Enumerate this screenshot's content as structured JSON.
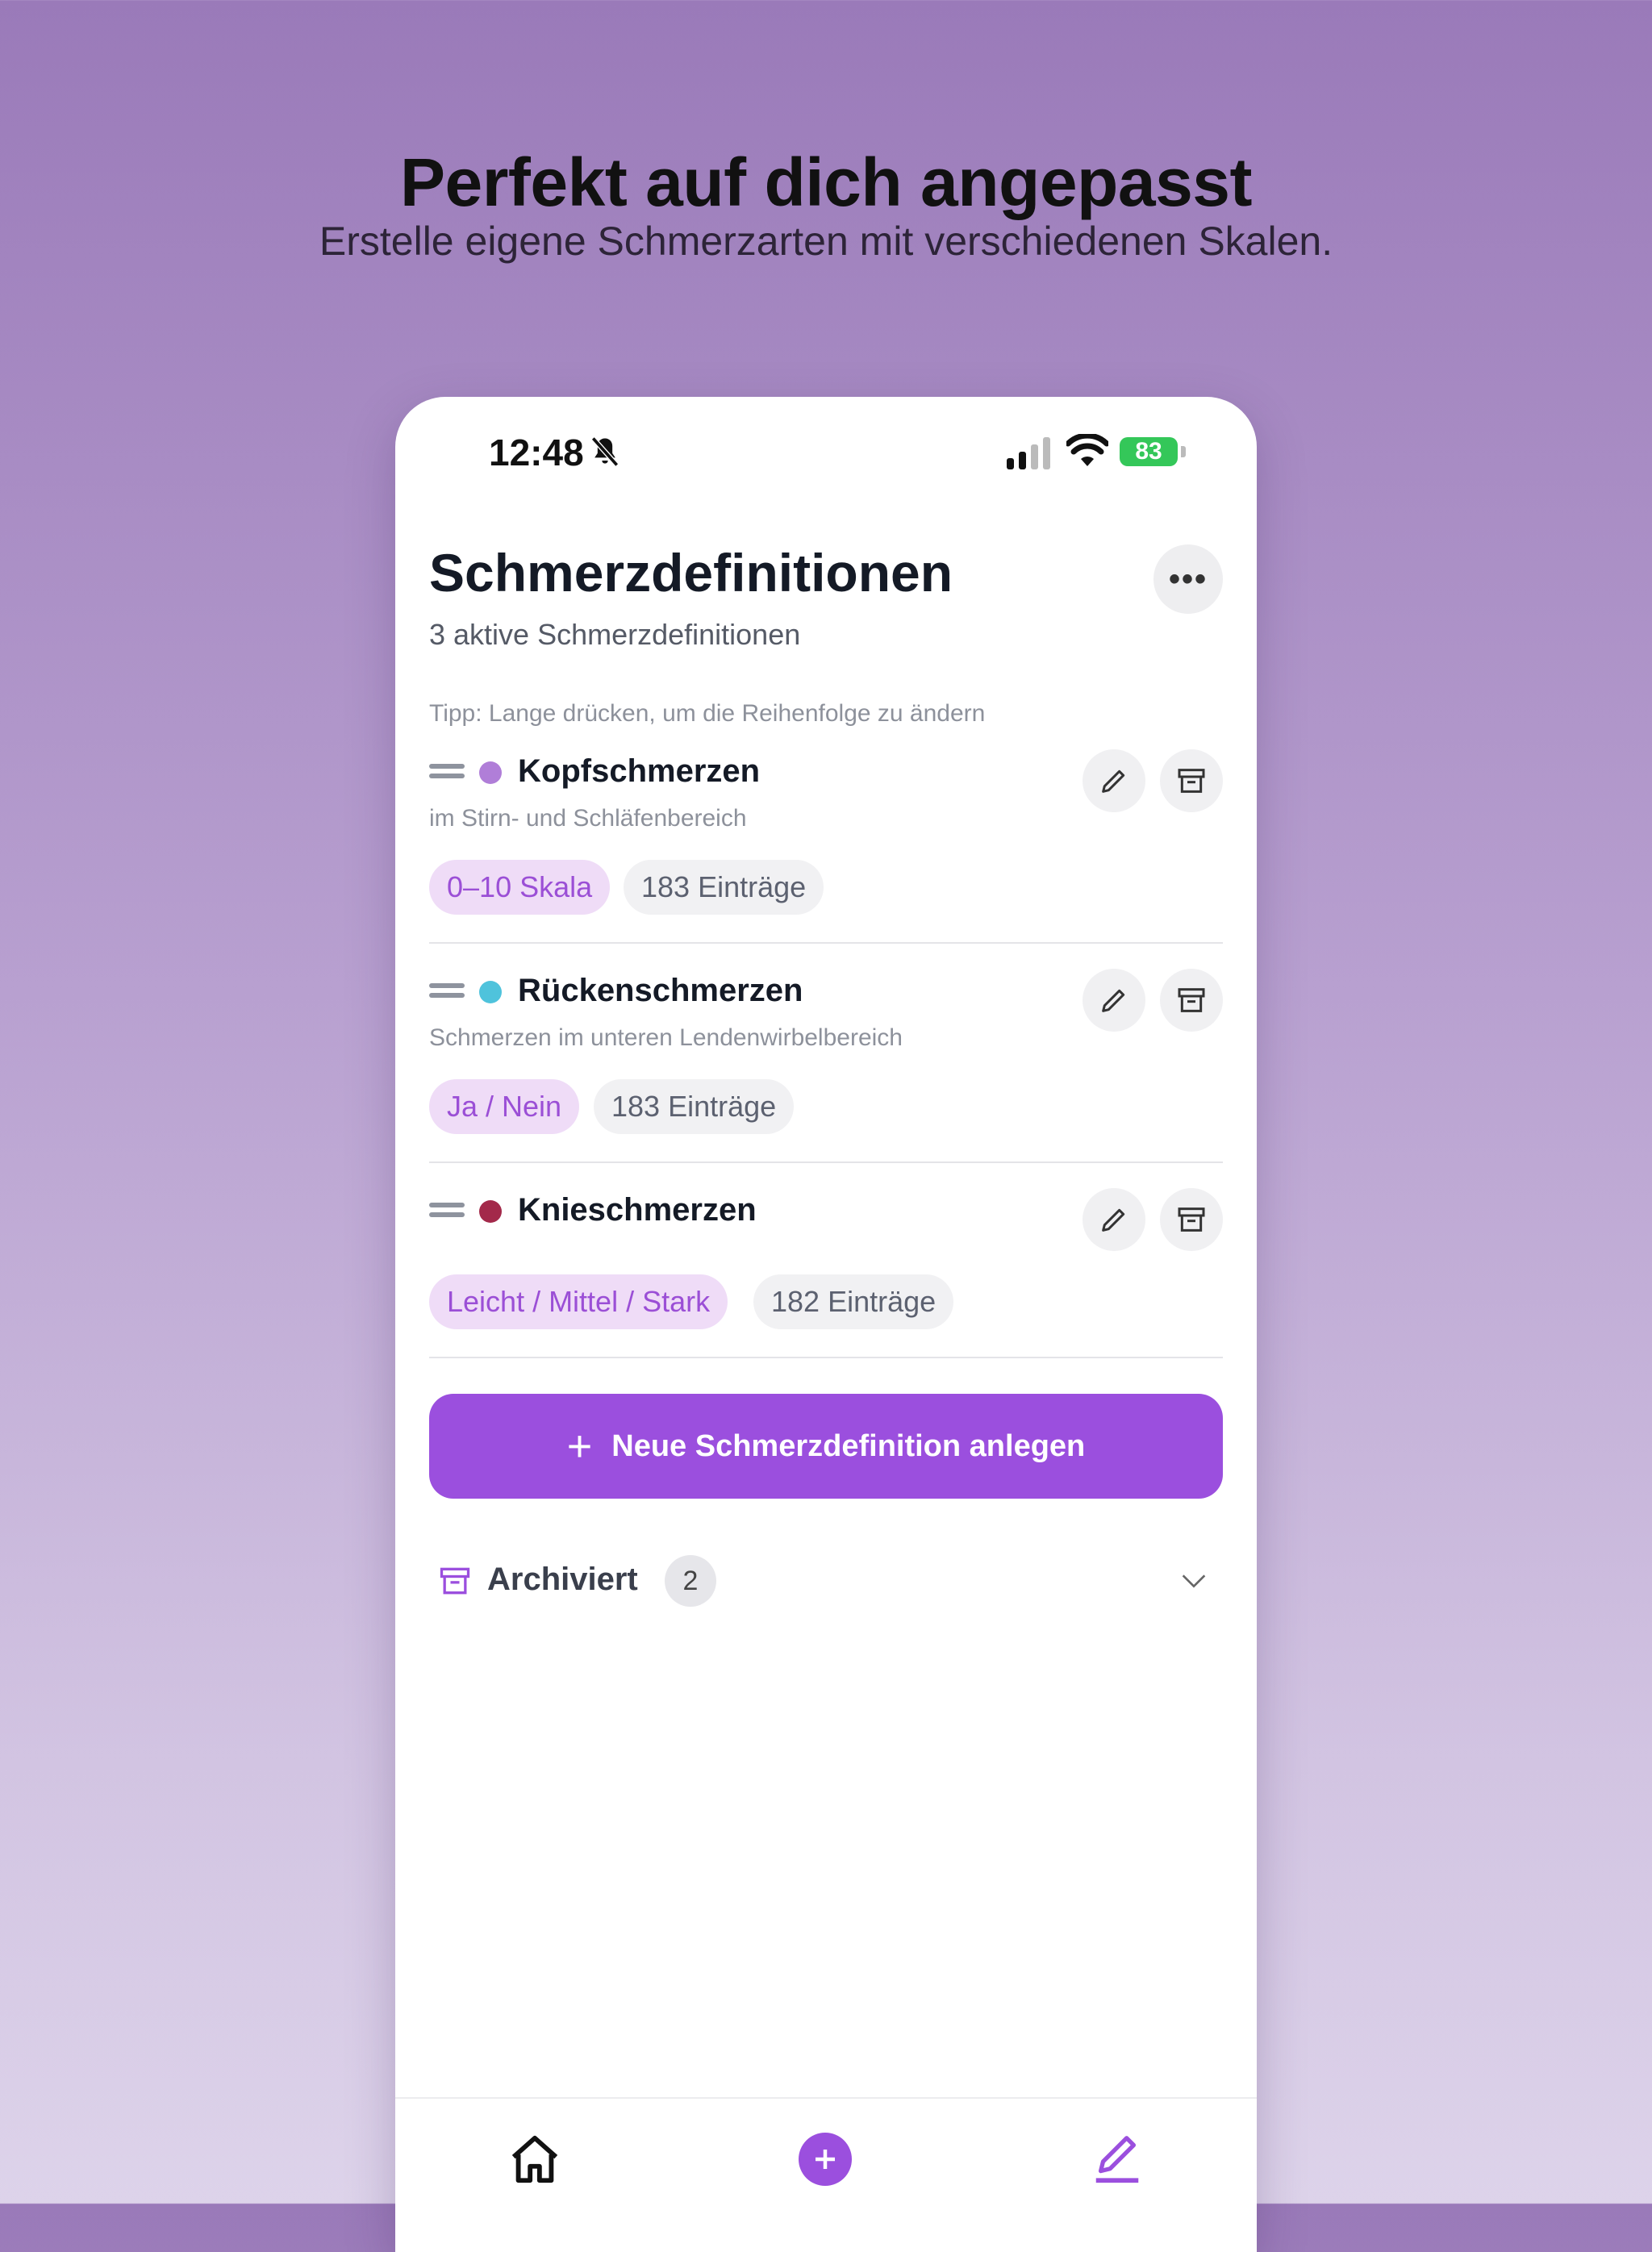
{
  "promo": {
    "headline": "Perfekt auf dich angepasst",
    "subheadline": "Erstelle eigene Schmerzarten mit verschiedenen Skalen."
  },
  "status_bar": {
    "time": "12:48",
    "battery": "83"
  },
  "header": {
    "title": "Schmerzdefinitionen",
    "subtitle": "3 aktive Schmerzdefinitionen",
    "more_label": "•••"
  },
  "tip": "Tipp: Lange drücken, um die Reihenfolge zu ändern",
  "definitions": [
    {
      "name": "Kopfschmerzen",
      "description": "im Stirn- und Schläfenbereich",
      "color": "#b07ed8",
      "scale": "0–10 Skala",
      "entries": "183 Einträge"
    },
    {
      "name": "Rückenschmerzen",
      "description": "Schmerzen im unteren Lendenwirbelbereich",
      "color": "#4fc3dc",
      "scale": "Ja / Nein",
      "entries": "183 Einträge"
    },
    {
      "name": "Knieschmerzen",
      "description": "",
      "color": "#a3294a",
      "scale": "Leicht / Mittel / Stark",
      "entries": "182 Einträge"
    }
  ],
  "new_button": {
    "icon": "+",
    "label": "Neue Schmerzdefinition anlegen"
  },
  "archived": {
    "label": "Archiviert",
    "count": "2"
  },
  "theme": {
    "accent": "#9b4fde",
    "chip_bg": "#efdcf7"
  }
}
